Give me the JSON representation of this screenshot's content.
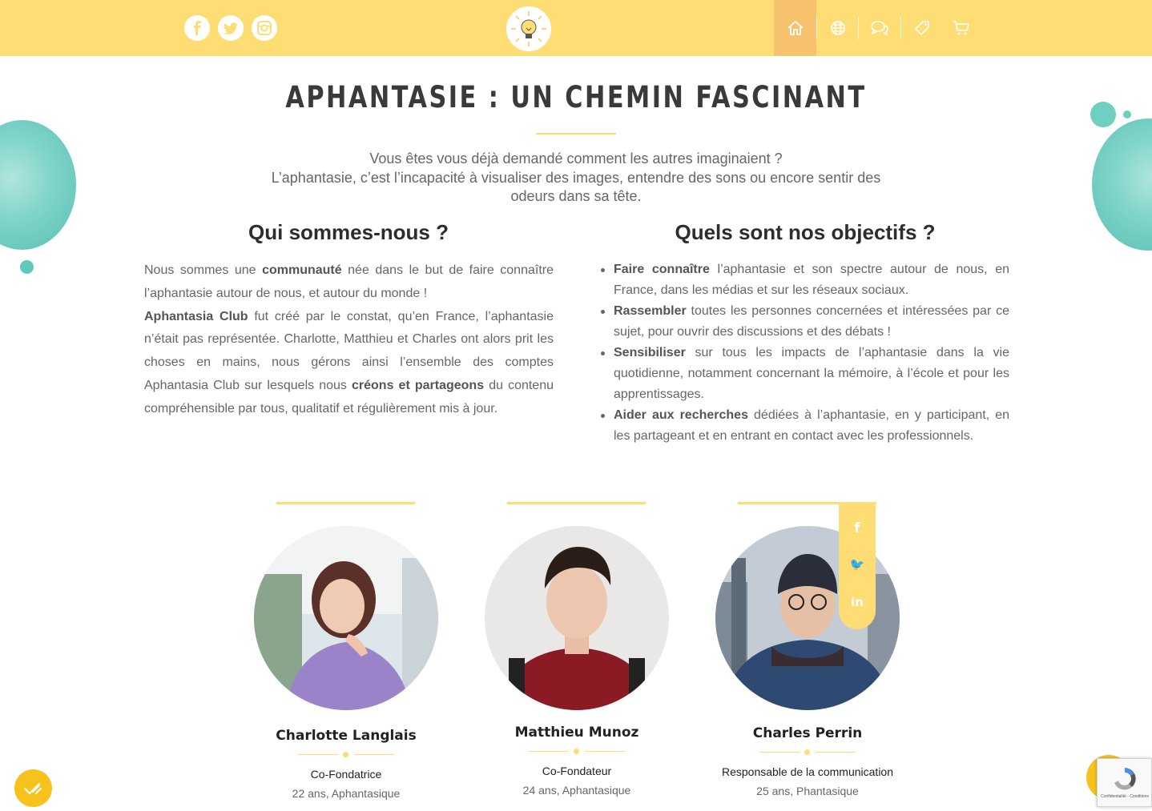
{
  "colors": {
    "header": "#fddd74",
    "accent": "#f6c26d",
    "turquoise": "#5fc9bd",
    "float": "#f7c21b"
  },
  "header": {
    "social": [
      {
        "name": "facebook-icon",
        "glyph": "f"
      },
      {
        "name": "twitter-icon",
        "glyph": "🐦"
      },
      {
        "name": "instagram-icon",
        "glyph": "◎"
      }
    ],
    "logo_alt": "lightbulb-logo",
    "nav": [
      "home-icon",
      "globe-icon",
      "chat-icon",
      "tag-icon",
      "cart-icon"
    ]
  },
  "page": {
    "title": "APHANTASIE : UN CHEMIN FASCINANT",
    "intro_line1": "Vous êtes vous déjà demandé comment les autres imaginaient ?",
    "intro_line2": "L’aphantasie, c’est l’incapacité à visualiser des images, entendre des sons ou encore sentir des odeurs dans sa tête."
  },
  "about": {
    "heading": "Qui sommes-nous ?",
    "p1_a": "Nous sommes une ",
    "p1_b": "communauté",
    "p1_c": " née dans le but de faire connaître l’aphantasie autour de nous, et autour du monde !",
    "p2_a": "Aphantasia Club",
    "p2_b": " fut créé par le constat, qu’en France, l’aphantasie n’était pas représentée. Charlotte, Matthieu et Charles ont alors prit les choses en mains, nous gérons ainsi l’ensemble des comptes Aphantasia Club sur lesquels nous ",
    "p2_c": "créons et partageons",
    "p2_d": " du contenu compréhensible par tous, qualitatif et régulièrement mis à jour."
  },
  "goals": {
    "heading": "Quels sont nos objectifs ?",
    "items": [
      {
        "bold": "Faire connaître",
        "text": " l’aphantasie et son spectre autour de nous, en France, dans les médias et sur les réseaux sociaux."
      },
      {
        "bold": "Rassembler",
        "text": " toutes les personnes concernées et intéressées par ce sujet, pour ouvrir des discussions et des débats !"
      },
      {
        "bold": "Sensibiliser",
        "text": " sur tous les impacts de l’aphantasie dans la vie quotidienne, notamment concernant la mémoire, à l’école et pour les apprentissages."
      },
      {
        "bold": "Aider aux recherches",
        "text": " dédiées à l’aphantasie, en y participant, en les partageant et en entrant en contact avec les professionnels."
      }
    ]
  },
  "team": [
    {
      "name": "Charlotte Langlais",
      "role": "Co-Fondatrice",
      "info": "22 ans, Aphantasique"
    },
    {
      "name": "Matthieu Munoz",
      "role": "Co-Fondateur",
      "info": "24 ans, Aphantasique"
    },
    {
      "name": "Charles Perrin",
      "role": "Responsable de la communication",
      "info": "25 ans, Phantasique"
    }
  ],
  "member_social": [
    "f",
    "🐦",
    "in"
  ],
  "recaptcha": "Confidentialité - Conditions"
}
